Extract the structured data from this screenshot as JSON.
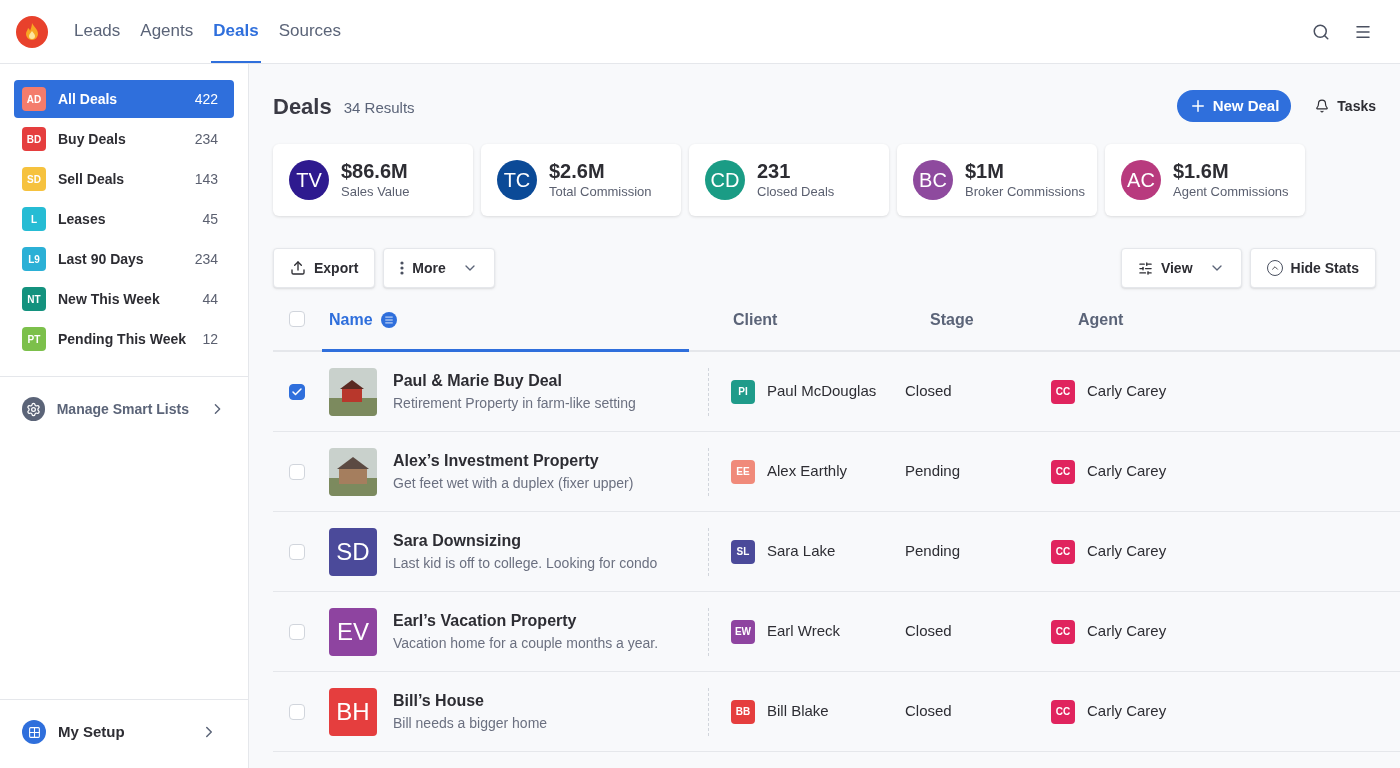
{
  "nav": {
    "tabs": [
      {
        "label": "Leads",
        "selected": false
      },
      {
        "label": "Agents",
        "selected": false
      },
      {
        "label": "Deals",
        "selected": true
      },
      {
        "label": "Sources",
        "selected": false
      }
    ]
  },
  "sidebar": {
    "items": [
      {
        "initials": "AD",
        "color": "#f47c6c",
        "label": "All Deals",
        "count": "422",
        "selected": true
      },
      {
        "initials": "BD",
        "color": "#e53e3e",
        "label": "Buy Deals",
        "count": "234",
        "selected": false
      },
      {
        "initials": "SD",
        "color": "#f6c23e",
        "label": "Sell Deals",
        "count": "143",
        "selected": false
      },
      {
        "initials": "L",
        "color": "#26bcd4",
        "label": "Leases",
        "count": "45",
        "selected": false
      },
      {
        "initials": "L9",
        "color": "#2bb0d6",
        "label": "Last 90 Days",
        "count": "234",
        "selected": false
      },
      {
        "initials": "NT",
        "color": "#14927e",
        "label": "New This Week",
        "count": "44",
        "selected": false
      },
      {
        "initials": "PT",
        "color": "#7cc04b",
        "label": "Pending This Week",
        "count": "12",
        "selected": false
      }
    ],
    "manage": "Manage Smart Lists",
    "setup": "My Setup"
  },
  "header": {
    "title": "Deals",
    "results": "34 Results",
    "new_button": "New Deal",
    "tasks": "Tasks"
  },
  "stats": [
    {
      "initials": "TV",
      "color": "#2e1a8f",
      "value": "$86.6M",
      "label": "Sales Value"
    },
    {
      "initials": "TC",
      "color": "#0b4a97",
      "value": "$2.6M",
      "label": "Total Commission"
    },
    {
      "initials": "CD",
      "color": "#1a9c85",
      "value": "231",
      "label": "Closed Deals"
    },
    {
      "initials": "BC",
      "color": "#8e4a9e",
      "value": "$1M",
      "label": "Broker Commissions"
    },
    {
      "initials": "AC",
      "color": "#b83a7e",
      "value": "$1.6M",
      "label": "Agent Commissions"
    }
  ],
  "toolbar": {
    "export": "Export",
    "more": "More",
    "view": "View",
    "hide_stats": "Hide Stats"
  },
  "table": {
    "all_checked": false,
    "columns": [
      {
        "label": "Name",
        "selected": true
      },
      {
        "label": "Client",
        "selected": false
      },
      {
        "label": "Stage",
        "selected": false
      },
      {
        "label": "Agent",
        "selected": false
      }
    ],
    "rows": [
      {
        "checked": true,
        "thumb": {
          "kind": "photo"
        },
        "title": "Paul & Marie Buy Deal",
        "subtitle": "Retirement Property in farm-like setting",
        "client": {
          "initials": "PI",
          "color": "#1f9b8a",
          "name": "Paul McDouglas"
        },
        "stage": "Closed",
        "agent": {
          "initials": "CC",
          "color": "#e0245e",
          "name": "Carly Carey"
        }
      },
      {
        "checked": false,
        "thumb": {
          "kind": "photo"
        },
        "title": "Alex’s Investment Property",
        "subtitle": "Get feet wet with a duplex (fixer upper)",
        "client": {
          "initials": "EE",
          "color": "#f08a7a",
          "name": "Alex Earthly"
        },
        "stage": "Pending",
        "agent": {
          "initials": "CC",
          "color": "#e0245e",
          "name": "Carly Carey"
        }
      },
      {
        "checked": false,
        "thumb": {
          "kind": "initials",
          "text": "SD",
          "color": "#4b4a9a"
        },
        "title": "Sara Downsizing",
        "subtitle": "Last kid is off to college. Looking for condo",
        "client": {
          "initials": "SL",
          "color": "#4b4a9a",
          "name": "Sara Lake"
        },
        "stage": "Pending",
        "agent": {
          "initials": "CC",
          "color": "#e0245e",
          "name": "Carly Carey"
        }
      },
      {
        "checked": false,
        "thumb": {
          "kind": "initials",
          "text": "EV",
          "color": "#8e44a0"
        },
        "title": "Earl’s Vacation Property",
        "subtitle": "Vacation home for a couple months a year.",
        "client": {
          "initials": "EW",
          "color": "#8e44a0",
          "name": "Earl Wreck"
        },
        "stage": "Closed",
        "agent": {
          "initials": "CC",
          "color": "#e0245e",
          "name": "Carly Carey"
        }
      },
      {
        "checked": false,
        "thumb": {
          "kind": "initials",
          "text": "BH",
          "color": "#e53e3e"
        },
        "title": "Bill’s House",
        "subtitle": "Bill needs a bigger home",
        "client": {
          "initials": "BB",
          "color": "#e53e3e",
          "name": "Bill Blake"
        },
        "stage": "Closed",
        "agent": {
          "initials": "CC",
          "color": "#e0245e",
          "name": "Carly Carey"
        }
      }
    ]
  }
}
